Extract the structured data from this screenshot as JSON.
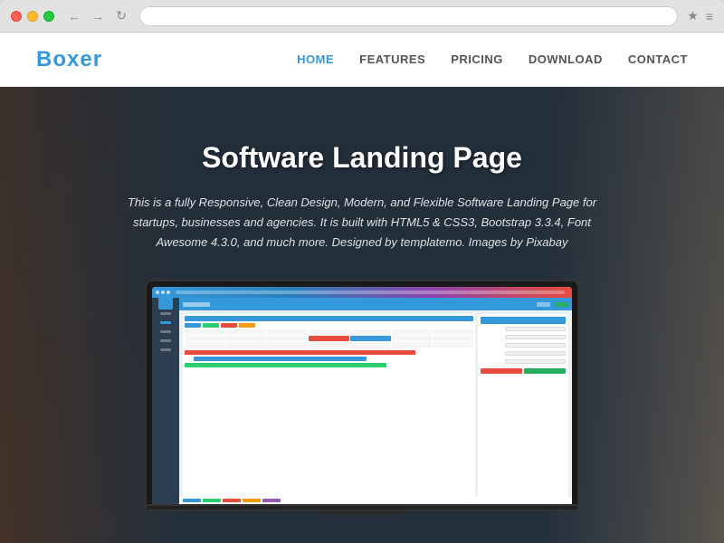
{
  "browser": {
    "dots": [
      "red",
      "yellow",
      "green"
    ],
    "back_arrow": "←",
    "forward_arrow": "→",
    "refresh": "↻",
    "address": "",
    "star": "★",
    "menu": "≡"
  },
  "nav": {
    "logo": "Boxer",
    "links": [
      {
        "label": "HOME",
        "active": true
      },
      {
        "label": "FEATURES",
        "active": false
      },
      {
        "label": "PRICING",
        "active": false
      },
      {
        "label": "DOWNLOAD",
        "active": false
      },
      {
        "label": "CONTACT",
        "active": false
      }
    ]
  },
  "hero": {
    "title": "Software Landing Page",
    "subtitle": "This is a fully Responsive, Clean Design, Modern, and Flexible Software Landing Page for startups, businesses and agencies. It is built with HTML5 & CSS3, Bootstrap 3.3.4, Font Awesome 4.3.0, and much more. Designed by templatemo. Images by Pixabay"
  },
  "colors": {
    "brand_blue": "#3498db",
    "dark_bg": "#2c3e50",
    "accent_red": "#e74c3c",
    "accent_green": "#27ae60"
  }
}
